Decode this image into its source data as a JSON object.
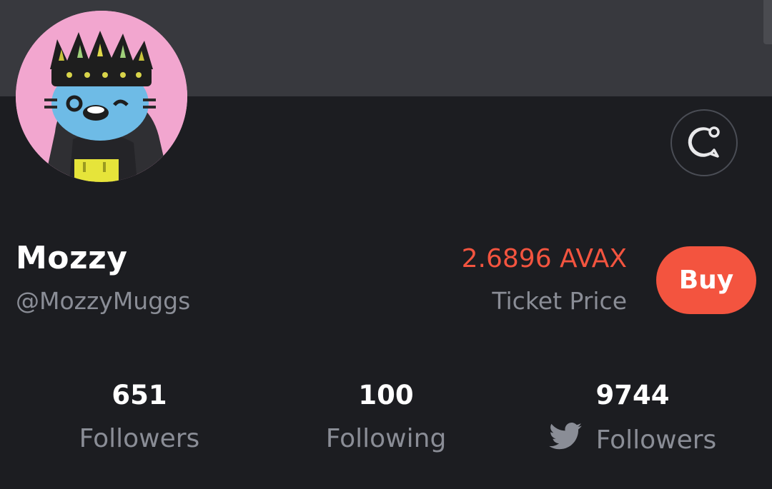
{
  "profile": {
    "name": "Mozzy",
    "handle": "@MozzyMuggs"
  },
  "ticket": {
    "price": "2.6896 AVAX",
    "label": "Ticket Price"
  },
  "actions": {
    "buy_label": "Buy"
  },
  "stats": {
    "followers": {
      "count": "651",
      "label": "Followers"
    },
    "following": {
      "count": "100",
      "label": "Following"
    },
    "twitter_followers": {
      "count": "9744",
      "label": "Followers",
      "icon": "twitter-icon"
    }
  },
  "colors": {
    "accent": "#f3543f",
    "background": "#1c1d21",
    "banner": "#38393e",
    "muted_text": "#8a8d96"
  }
}
